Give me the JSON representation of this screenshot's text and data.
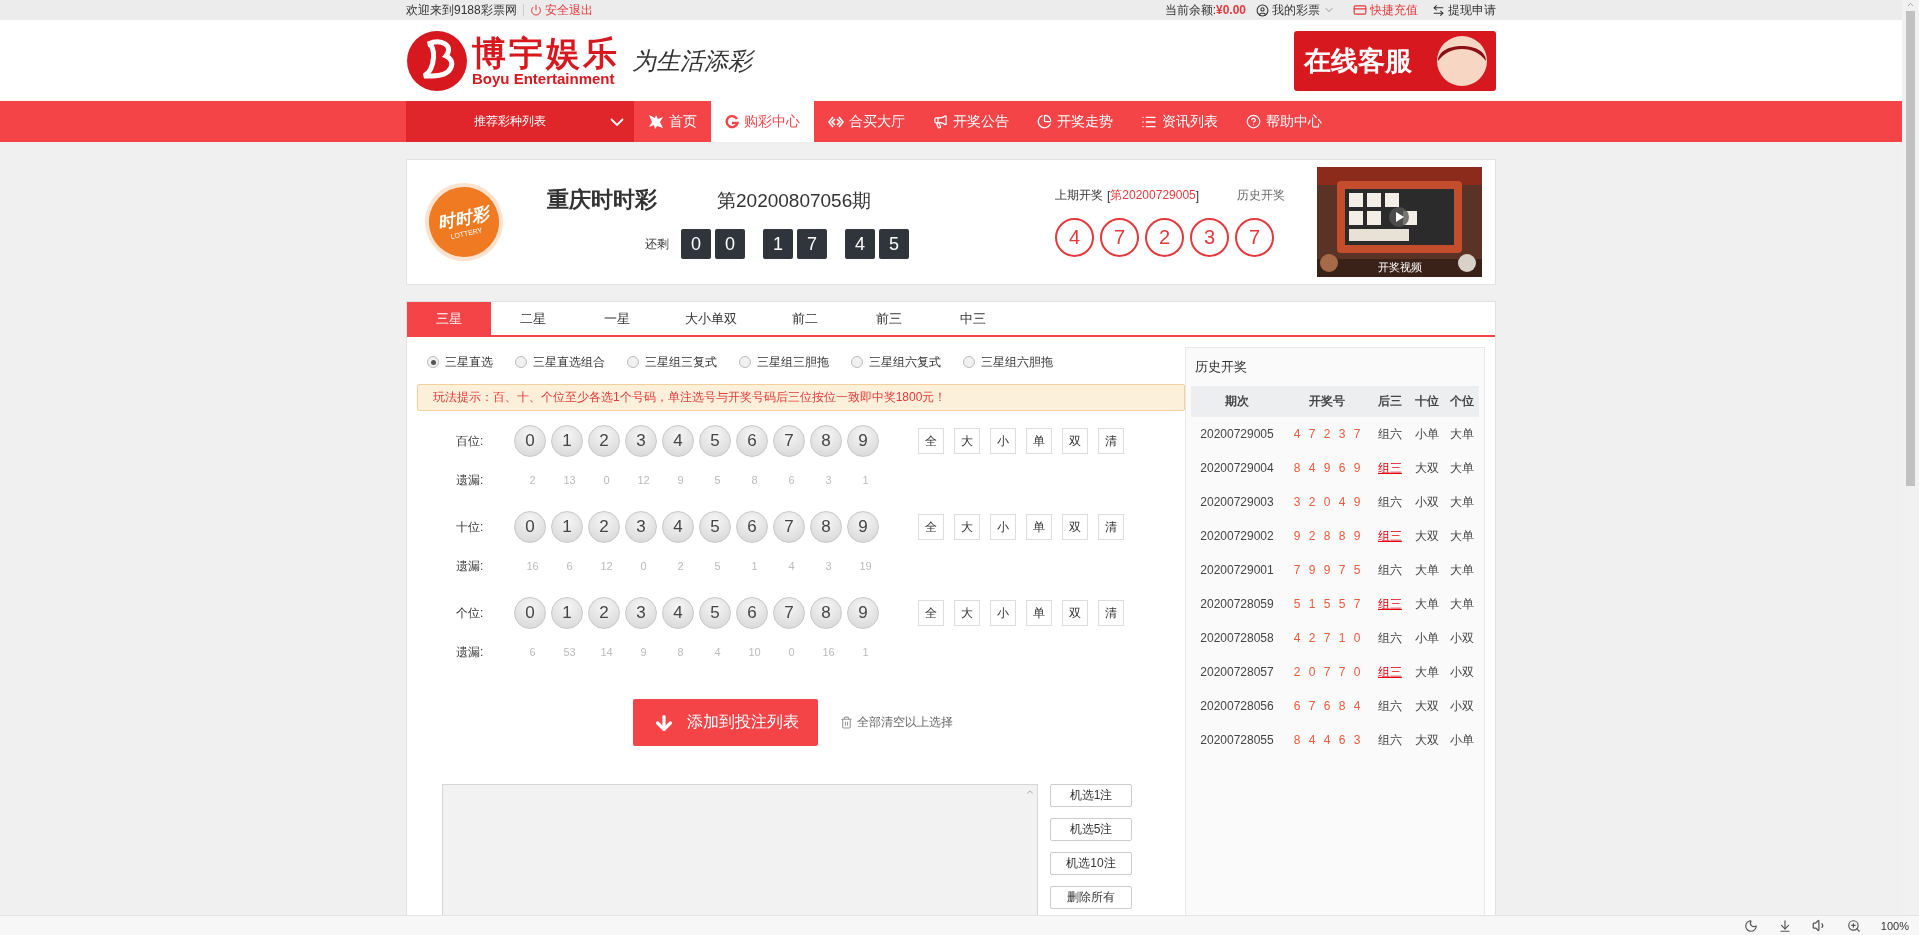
{
  "top_bar": {
    "welcome": "欢迎来到9188彩票网",
    "logout": "安全退出",
    "balance_label": "当前余额:",
    "balance": "¥0.00",
    "my_lottery": "我的彩票",
    "recharge": "快捷充值",
    "withdraw": "提现申请"
  },
  "header": {
    "logo_cn": "博宇娱乐",
    "logo_en": "Boyu Entertainment",
    "slogan": "为生活添彩",
    "service": "在线客服"
  },
  "nav": {
    "dropdown": "推荐彩种列表",
    "items": [
      {
        "label": "首页",
        "selected": false
      },
      {
        "label": "购彩中心",
        "selected": true
      },
      {
        "label": "合买大厅",
        "selected": false
      },
      {
        "label": "开奖公告",
        "selected": false
      },
      {
        "label": "开奖走势",
        "selected": false
      },
      {
        "label": "资讯列表",
        "selected": false
      },
      {
        "label": "帮助中心",
        "selected": false
      }
    ]
  },
  "lottery": {
    "logo_text": "时时彩",
    "logo_sub": "LOTTERY",
    "name": "重庆时时彩",
    "issue": "第20200807056期",
    "countdown_label": "还剩",
    "countdown": [
      "0",
      "0",
      "1",
      "7",
      "4",
      "5"
    ],
    "last_label": "上期开奖",
    "bracket_open": "[",
    "last_issue": "第20200729005",
    "bracket_close": "]",
    "history_link": "历史开奖",
    "last_numbers": [
      "4",
      "7",
      "2",
      "3",
      "7"
    ],
    "video_label": "开奖视频"
  },
  "tabs": [
    {
      "label": "三星",
      "selected": true
    },
    {
      "label": "二星",
      "selected": false
    },
    {
      "label": "一星",
      "selected": false
    },
    {
      "label": "大小单双",
      "selected": false
    },
    {
      "label": "前二",
      "selected": false
    },
    {
      "label": "前三",
      "selected": false
    },
    {
      "label": "中三",
      "selected": false
    }
  ],
  "play_types": [
    {
      "label": "三星直选",
      "selected": true
    },
    {
      "label": "三星直选组合",
      "selected": false
    },
    {
      "label": "三星组三复式",
      "selected": false
    },
    {
      "label": "三星组三胆拖",
      "selected": false
    },
    {
      "label": "三星组六复式",
      "selected": false
    },
    {
      "label": "三星组六胆拖",
      "selected": false
    }
  ],
  "tip": "玩法提示：百、十、个位至少各选1个号码，单注选号与开奖号码后三位按位一致即中奖1800元！",
  "positions": [
    {
      "label": "百位:",
      "balls": [
        "0",
        "1",
        "2",
        "3",
        "4",
        "5",
        "6",
        "7",
        "8",
        "9"
      ],
      "quick_buttons": [
        "全",
        "大",
        "小",
        "单",
        "双",
        "清"
      ],
      "missing_label": "遗漏:",
      "missing": [
        "2",
        "13",
        "0",
        "12",
        "9",
        "5",
        "8",
        "6",
        "3",
        "1"
      ]
    },
    {
      "label": "十位:",
      "balls": [
        "0",
        "1",
        "2",
        "3",
        "4",
        "5",
        "6",
        "7",
        "8",
        "9"
      ],
      "quick_buttons": [
        "全",
        "大",
        "小",
        "单",
        "双",
        "清"
      ],
      "missing_label": "遗漏:",
      "missing": [
        "16",
        "6",
        "12",
        "0",
        "2",
        "5",
        "1",
        "4",
        "3",
        "19"
      ]
    },
    {
      "label": "个位:",
      "balls": [
        "0",
        "1",
        "2",
        "3",
        "4",
        "5",
        "6",
        "7",
        "8",
        "9"
      ],
      "quick_buttons": [
        "全",
        "大",
        "小",
        "单",
        "双",
        "清"
      ],
      "missing_label": "遗漏:",
      "missing": [
        "6",
        "53",
        "14",
        "9",
        "8",
        "4",
        "10",
        "0",
        "16",
        "1"
      ]
    }
  ],
  "add_button": "添加到投注列表",
  "clear_all": "全部清空以上选择",
  "random_buttons": [
    "机选1注",
    "机选5注",
    "机选10注",
    "删除所有"
  ],
  "history": {
    "title": "历史开奖",
    "columns": [
      "期次",
      "开奖号",
      "后三",
      "十位",
      "个位"
    ],
    "rows": [
      {
        "issue": "20200729005",
        "numbers": [
          "4",
          "7",
          "2",
          "3",
          "7"
        ],
        "type": "组六",
        "highlight": false,
        "tens": "小单",
        "units": "大单"
      },
      {
        "issue": "20200729004",
        "numbers": [
          "8",
          "4",
          "9",
          "6",
          "9"
        ],
        "type": "组三",
        "highlight": true,
        "tens": "大双",
        "units": "大单"
      },
      {
        "issue": "20200729003",
        "numbers": [
          "3",
          "2",
          "0",
          "4",
          "9"
        ],
        "type": "组六",
        "highlight": false,
        "tens": "小双",
        "units": "大单"
      },
      {
        "issue": "20200729002",
        "numbers": [
          "9",
          "2",
          "8",
          "8",
          "9"
        ],
        "type": "组三",
        "highlight": true,
        "tens": "大双",
        "units": "大单"
      },
      {
        "issue": "20200729001",
        "numbers": [
          "7",
          "9",
          "9",
          "7",
          "5"
        ],
        "type": "组六",
        "highlight": false,
        "tens": "大单",
        "units": "大单"
      },
      {
        "issue": "20200728059",
        "numbers": [
          "5",
          "1",
          "5",
          "5",
          "7"
        ],
        "type": "组三",
        "highlight": true,
        "tens": "大单",
        "units": "大单"
      },
      {
        "issue": "20200728058",
        "numbers": [
          "4",
          "2",
          "7",
          "1",
          "0"
        ],
        "type": "组六",
        "highlight": false,
        "tens": "小单",
        "units": "小双"
      },
      {
        "issue": "20200728057",
        "numbers": [
          "2",
          "0",
          "7",
          "7",
          "0"
        ],
        "type": "组三",
        "highlight": true,
        "tens": "大单",
        "units": "小双"
      },
      {
        "issue": "20200728056",
        "numbers": [
          "6",
          "7",
          "6",
          "8",
          "4"
        ],
        "type": "组六",
        "highlight": false,
        "tens": "大双",
        "units": "小双"
      },
      {
        "issue": "20200728055",
        "numbers": [
          "8",
          "4",
          "4",
          "6",
          "3"
        ],
        "type": "组六",
        "highlight": false,
        "tens": "大双",
        "units": "小单"
      }
    ]
  },
  "status_bar": {
    "zoom": "100%"
  }
}
